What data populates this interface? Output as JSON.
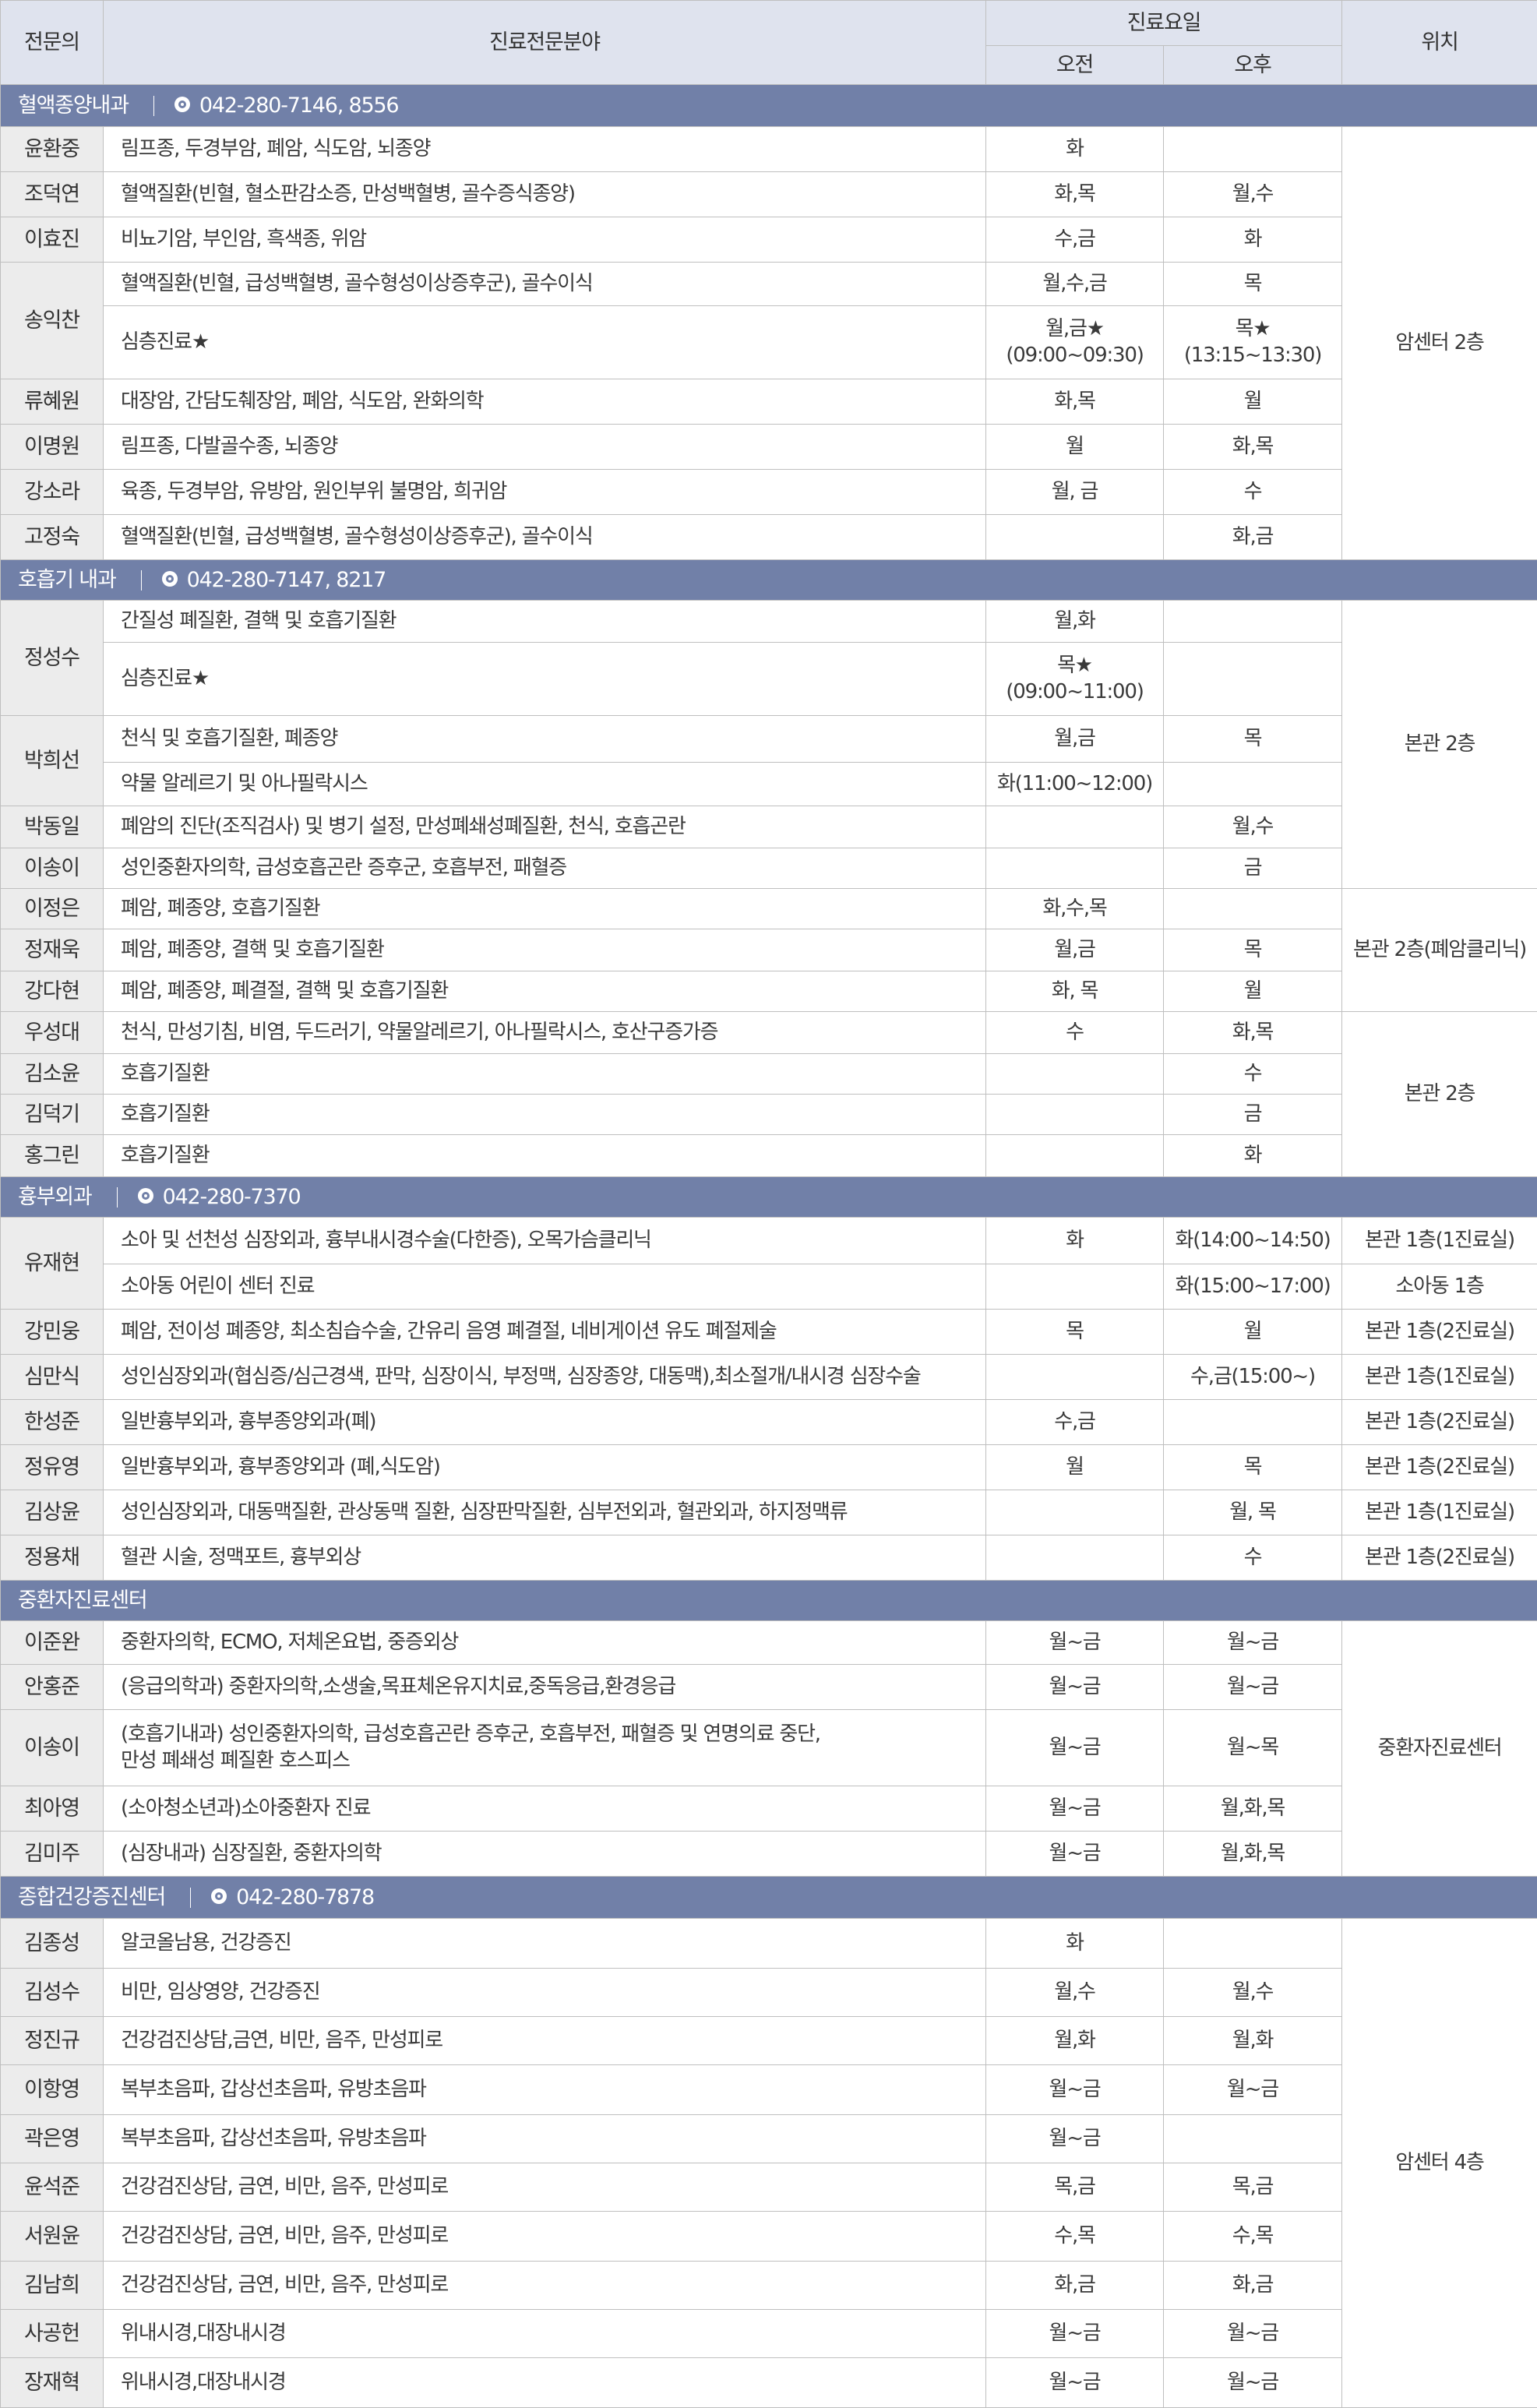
{
  "header": {
    "specialist": "전문의",
    "field": "진료전문분야",
    "schedule": "진료요일",
    "am": "오전",
    "pm": "오후",
    "location": "위치"
  },
  "sections": [
    {
      "name": "혈액종양내과",
      "phone": "042-280-7146, 8556",
      "location": "암센터 2층",
      "rows": [
        {
          "doctor": "윤환중",
          "field": "림프종, 두경부암, 폐암, 식도암, 뇌종양",
          "am": "화",
          "pm": ""
        },
        {
          "doctor": "조덕연",
          "field": "혈액질환(빈혈, 혈소판감소증, 만성백혈병, 골수증식종양)",
          "am": "화,목",
          "pm": "월,수"
        },
        {
          "doctor": "이효진",
          "field": "비뇨기암, 부인암, 흑색종, 위암",
          "am": "수,금",
          "pm": "화"
        },
        {
          "doctor": "송익찬",
          "field": "혈액질환(빈혈, 급성백혈병, 골수형성이상증후군), 골수이식",
          "am": "월,수,금",
          "pm": "목"
        },
        {
          "doctor": "",
          "field": "심층진료★",
          "am": "월,금★",
          "am2": "(09:00~09:30)",
          "pm": "목★",
          "pm2": "(13:15~13:30)"
        },
        {
          "doctor": "류혜원",
          "field": "대장암, 간담도췌장암, 폐암, 식도암, 완화의학",
          "am": "화,목",
          "pm": "월"
        },
        {
          "doctor": "이명원",
          "field": "림프종, 다발골수종, 뇌종양",
          "am": "월",
          "pm": "화,목"
        },
        {
          "doctor": "강소라",
          "field": "육종, 두경부암, 유방암, 원인부위 불명암, 희귀암",
          "am": "월, 금",
          "pm": "수"
        },
        {
          "doctor": "고정숙",
          "field": "혈액질환(빈혈, 급성백혈병, 골수형성이상증후군), 골수이식",
          "am": "",
          "pm": "화,금"
        }
      ]
    },
    {
      "name": "호흡기 내과",
      "phone": "042-280-7147, 8217",
      "location_1": "본관 2층",
      "location_2": "본관 2층(폐암클리닉)",
      "location_3": "본관 2층",
      "rows": [
        {
          "doctor": "정성수",
          "field": "간질성 폐질환, 결핵 및 호흡기질환",
          "am": "월,화",
          "pm": ""
        },
        {
          "doctor": "",
          "field": "심층진료★",
          "am": "목★",
          "am2": "(09:00~11:00)",
          "pm": ""
        },
        {
          "doctor": "박희선",
          "field": "천식 및 호흡기질환, 폐종양",
          "am": "월,금",
          "pm": "목"
        },
        {
          "doctor": "",
          "field": "약물 알레르기 및 아나필락시스",
          "am": "화(11:00~12:00)",
          "pm": ""
        },
        {
          "doctor": "박동일",
          "field": "폐암의 진단(조직검사) 및 병기 설정, 만성폐쇄성폐질환, 천식, 호흡곤란",
          "am": "",
          "pm": "월,수"
        },
        {
          "doctor": "이송이",
          "field": "성인중환자의학, 급성호흡곤란 증후군, 호흡부전, 패혈증",
          "am": "",
          "pm": "금"
        },
        {
          "doctor": "이정은",
          "field": "폐암, 폐종양, 호흡기질환",
          "am": "화,수,목",
          "pm": ""
        },
        {
          "doctor": "정재욱",
          "field": "폐암, 폐종양, 결핵 및 호흡기질환",
          "am": "월,금",
          "pm": "목"
        },
        {
          "doctor": "강다현",
          "field": "폐암, 폐종양, 폐결절, 결핵 및 호흡기질환",
          "am": "화, 목",
          "pm": "월"
        },
        {
          "doctor": "우성대",
          "field": "천식, 만성기침, 비염, 두드러기, 약물알레르기, 아나필락시스, 호산구증가증",
          "am": "수",
          "pm": "화,목"
        },
        {
          "doctor": "김소윤",
          "field": "호흡기질환",
          "am": "",
          "pm": "수"
        },
        {
          "doctor": "김덕기",
          "field": "호흡기질환",
          "am": "",
          "pm": "금"
        },
        {
          "doctor": "홍그린",
          "field": "호흡기질환",
          "am": "",
          "pm": "화"
        }
      ]
    },
    {
      "name": "흉부외과",
      "phone": "042-280-7370",
      "rows": [
        {
          "doctor": "유재현",
          "field": "소아 및 선천성 심장외과, 흉부내시경수술(다한증), 오목가슴클리닉",
          "am": "화",
          "pm": "화(14:00~14:50)",
          "loc": "본관 1층(1진료실)"
        },
        {
          "doctor": "",
          "field": "소아동 어린이 센터 진료",
          "am": "",
          "pm": "화(15:00~17:00)",
          "loc": "소아동 1층"
        },
        {
          "doctor": "강민웅",
          "field": "폐암, 전이성 폐종양, 최소침습수술, 간유리 음영 폐결절, 네비게이션 유도 폐절제술",
          "am": "목",
          "pm": "월",
          "loc": "본관 1층(2진료실)"
        },
        {
          "doctor": "심만식",
          "field": "성인심장외과(협심증/심근경색, 판막, 심장이식, 부정맥, 심장종양, 대동맥),최소절개/내시경 심장수술",
          "am": "",
          "pm": "수,금(15:00~)",
          "loc": "본관 1층(1진료실)"
        },
        {
          "doctor": "한성준",
          "field": "일반흉부외과, 흉부종양외과(폐)",
          "am": "수,금",
          "pm": "",
          "loc": "본관 1층(2진료실)"
        },
        {
          "doctor": "정유영",
          "field": "일반흉부외과, 흉부종양외과 (폐,식도암)",
          "am": "월",
          "pm": "목",
          "loc": "본관 1층(2진료실)"
        },
        {
          "doctor": "김상윤",
          "field": "성인심장외과, 대동맥질환, 관상동맥 질환, 심장판막질환, 심부전외과, 혈관외과, 하지정맥류",
          "am": "",
          "pm": "월, 목",
          "loc": "본관 1층(1진료실)"
        },
        {
          "doctor": "정용채",
          "field": "혈관 시술, 정맥포트, 흉부외상",
          "am": "",
          "pm": "수",
          "loc": "본관 1층(2진료실)"
        }
      ]
    },
    {
      "name": "중환자진료센터",
      "location": "중환자진료센터",
      "rows": [
        {
          "doctor": "이준완",
          "field": "중환자의학, ECMO, 저체온요법, 중증외상",
          "am": "월~금",
          "pm": "월~금"
        },
        {
          "doctor": "안홍준",
          "field": "(응급의학과) 중환자의학,소생술,목표체온유지치료,중독응급,환경응급",
          "am": "월~금",
          "pm": "월~금"
        },
        {
          "doctor": "이송이",
          "field": "(호흡기내과) 성인중환자의학, 급성호흡곤란 증후군, 호흡부전, 패혈증 및 연명의료 중단,",
          "field2": "만성 폐쇄성 폐질환 호스피스",
          "am": "월~금",
          "pm": "월~목"
        },
        {
          "doctor": "최아영",
          "field": "(소아청소년과)소아중환자 진료",
          "am": "월~금",
          "pm": "월,화,목"
        },
        {
          "doctor": "김미주",
          "field": "(심장내과) 심장질환, 중환자의학",
          "am": "월~금",
          "pm": "월,화,목"
        }
      ]
    },
    {
      "name": "종합건강증진센터",
      "phone": "042-280-7878",
      "location": "암센터 4층",
      "rows": [
        {
          "doctor": "김종성",
          "field": "알코올남용, 건강증진",
          "am": "화",
          "pm": ""
        },
        {
          "doctor": "김성수",
          "field": "비만, 임상영양, 건강증진",
          "am": "월,수",
          "pm": "월,수"
        },
        {
          "doctor": "정진규",
          "field": "건강검진상담,금연, 비만, 음주, 만성피로",
          "am": "월,화",
          "pm": "월,화"
        },
        {
          "doctor": "이항영",
          "field": "복부초음파, 갑상선초음파, 유방초음파",
          "am": "월~금",
          "pm": "월~금"
        },
        {
          "doctor": "곽은영",
          "field": "복부초음파, 갑상선초음파, 유방초음파",
          "am": "월~금",
          "pm": ""
        },
        {
          "doctor": "윤석준",
          "field": "건강검진상담, 금연, 비만, 음주, 만성피로",
          "am": "목,금",
          "pm": "목,금"
        },
        {
          "doctor": "서원윤",
          "field": "건강검진상담, 금연, 비만, 음주, 만성피로",
          "am": "수,목",
          "pm": "수,목"
        },
        {
          "doctor": "김남희",
          "field": "건강검진상담, 금연, 비만, 음주, 만성피로",
          "am": "화,금",
          "pm": "화,금"
        },
        {
          "doctor": "사공헌",
          "field": "위내시경,대장내시경",
          "am": "월~금",
          "pm": "월~금"
        },
        {
          "doctor": "장재혁",
          "field": "위내시경,대장내시경",
          "am": "월~금",
          "pm": "월~금"
        }
      ]
    }
  ]
}
